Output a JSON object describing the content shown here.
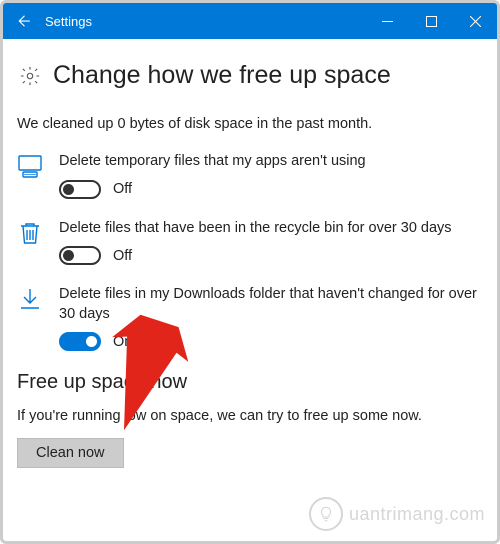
{
  "titlebar": {
    "title": "Settings"
  },
  "page": {
    "heading": "Change how we free up space",
    "status": "We cleaned up 0 bytes of disk space in the past month."
  },
  "options": [
    {
      "label": "Delete temporary files that my apps aren't using",
      "value": false,
      "state_text": "Off"
    },
    {
      "label": "Delete files that have been in the recycle bin for over 30 days",
      "value": false,
      "state_text": "Off"
    },
    {
      "label": "Delete files in my Downloads folder that haven't changed for over 30 days",
      "value": true,
      "state_text": "On"
    }
  ],
  "free_up": {
    "heading": "Free up space now",
    "body": "If you're running low on space, we can try to free up some now.",
    "button": "Clean now"
  },
  "watermark": "uantrimang.com"
}
